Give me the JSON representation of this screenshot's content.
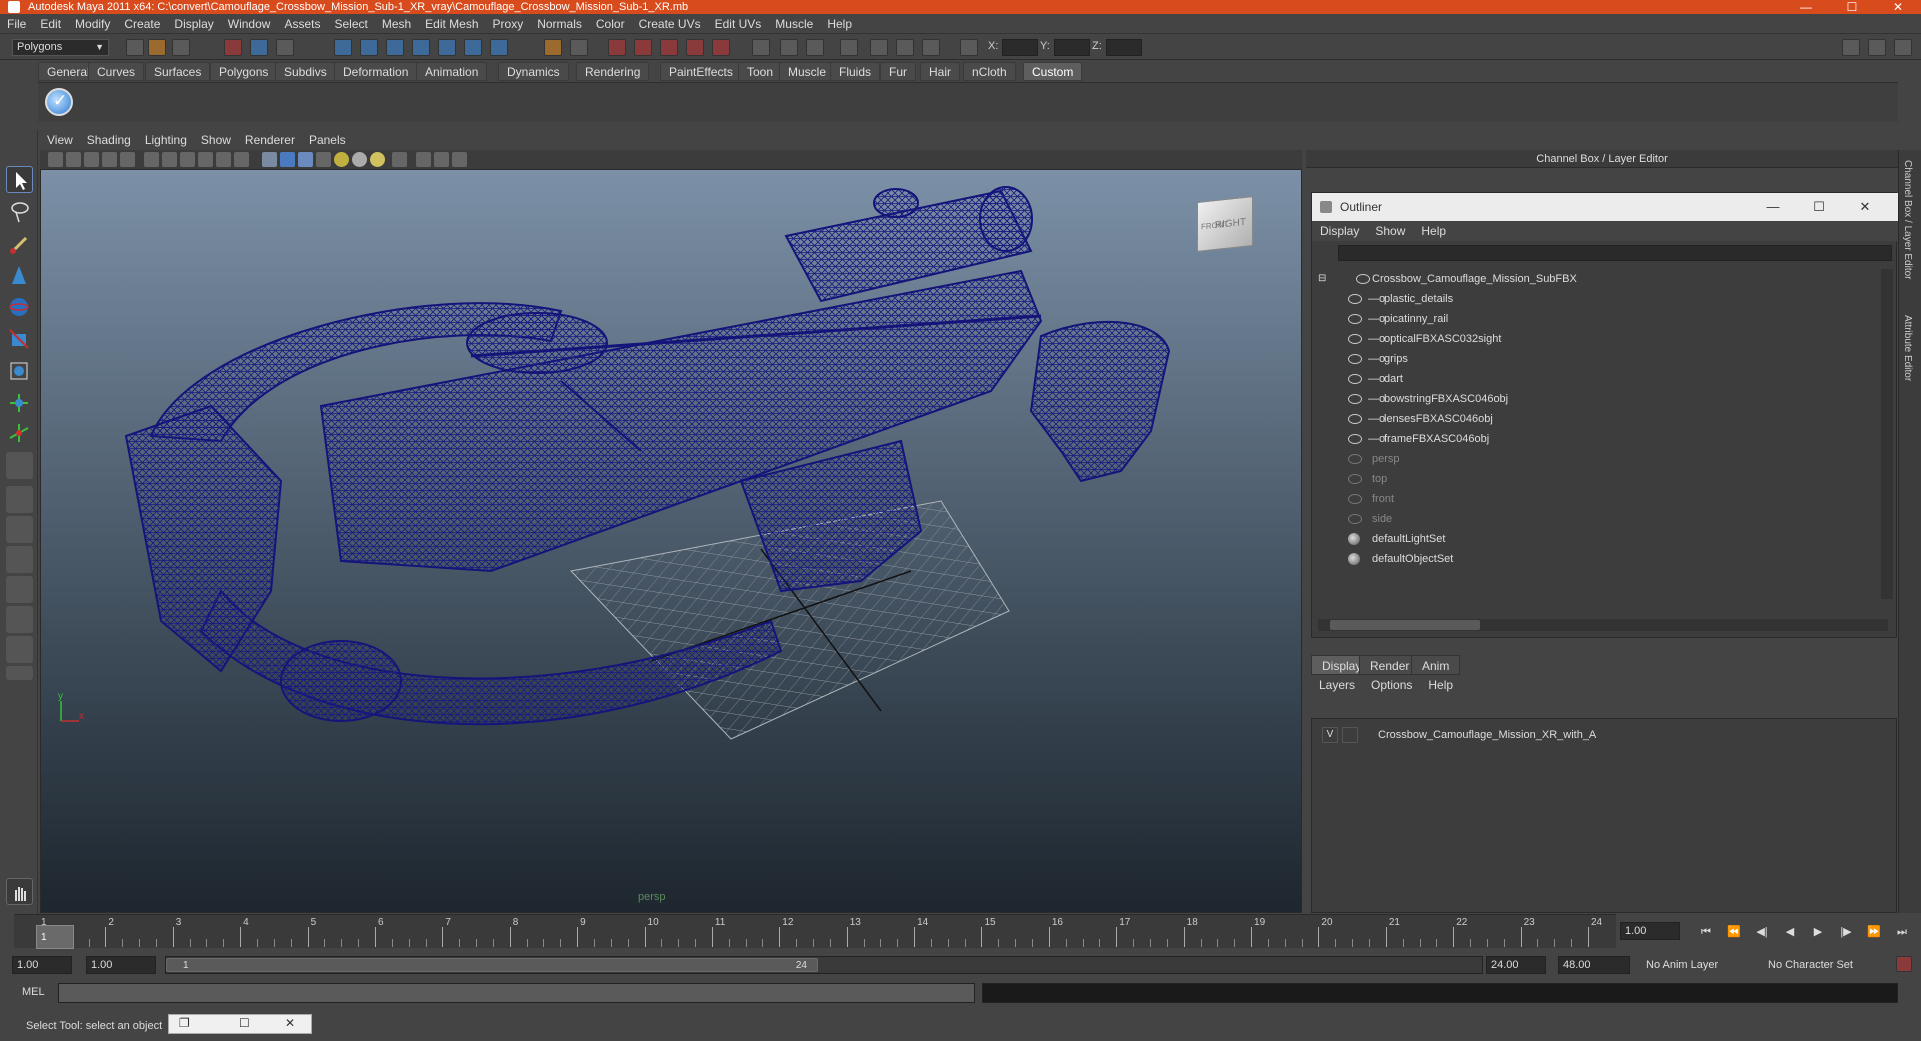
{
  "window": {
    "title": "Autodesk Maya 2011 x64: C:\\convert\\Camouflage_Crossbow_Mission_Sub-1_XR_vray\\Camouflage_Crossbow_Mission_Sub-1_XR.mb",
    "min": "—",
    "max": "☐",
    "close": "✕"
  },
  "menubar": [
    "File",
    "Edit",
    "Modify",
    "Create",
    "Display",
    "Window",
    "Assets",
    "Select",
    "Mesh",
    "Edit Mesh",
    "Proxy",
    "Normals",
    "Color",
    "Create UVs",
    "Edit UVs",
    "Muscle",
    "Help"
  ],
  "statusline": {
    "mode": "Polygons",
    "x_label": "X:",
    "y_label": "Y:",
    "z_label": "Z:"
  },
  "shelf": {
    "tabs": [
      "General",
      "Curves",
      "Surfaces",
      "Polygons",
      "Subdivs",
      "Deformation",
      "Animation",
      "Dynamics",
      "Rendering",
      "PaintEffects",
      "Toon",
      "Muscle",
      "Fluids",
      "Fur",
      "Hair",
      "nCloth",
      "Custom"
    ],
    "active": "Custom"
  },
  "viewport": {
    "menu": [
      "View",
      "Shading",
      "Lighting",
      "Show",
      "Renderer",
      "Panels"
    ],
    "camera_label": "persp",
    "viewcube_front": "FRONT",
    "viewcube_right": "RIGHT",
    "axis_x": "x",
    "axis_y": "y"
  },
  "channel_box": {
    "title": "Channel Box / Layer Editor"
  },
  "outliner": {
    "title": "Outliner",
    "min": "—",
    "max": "☐",
    "close": "✕",
    "menu": [
      "Display",
      "Show",
      "Help"
    ],
    "items": [
      {
        "label": "Crossbow_Camouflage_Mission_SubFBX",
        "indent": 0,
        "kind": "group"
      },
      {
        "label": "plastic_details",
        "indent": 1,
        "kind": "mesh"
      },
      {
        "label": "picatinny_rail",
        "indent": 1,
        "kind": "mesh"
      },
      {
        "label": "opticalFBXASC032sight",
        "indent": 1,
        "kind": "mesh"
      },
      {
        "label": "grips",
        "indent": 1,
        "kind": "mesh"
      },
      {
        "label": "dart",
        "indent": 1,
        "kind": "mesh"
      },
      {
        "label": "bowstringFBXASC046obj",
        "indent": 1,
        "kind": "mesh"
      },
      {
        "label": "lensesFBXASC046obj",
        "indent": 1,
        "kind": "mesh"
      },
      {
        "label": "frameFBXASC046obj",
        "indent": 1,
        "kind": "mesh"
      },
      {
        "label": "persp",
        "indent": 0,
        "kind": "camera"
      },
      {
        "label": "top",
        "indent": 0,
        "kind": "camera"
      },
      {
        "label": "front",
        "indent": 0,
        "kind": "camera"
      },
      {
        "label": "side",
        "indent": 0,
        "kind": "camera"
      },
      {
        "label": "defaultLightSet",
        "indent": 0,
        "kind": "set"
      },
      {
        "label": "defaultObjectSet",
        "indent": 0,
        "kind": "set"
      }
    ]
  },
  "layer_editor": {
    "tabs": [
      "Display",
      "Render",
      "Anim"
    ],
    "active": "Display",
    "menu": [
      "Layers",
      "Options",
      "Help"
    ],
    "layer": {
      "visible": "V",
      "name": "Crossbow_Camouflage_Mission_XR_with_A"
    }
  },
  "side_tabs": [
    "Channel Box / Layer Editor",
    "Attribute Editor"
  ],
  "timeslider": {
    "labels": [
      "1",
      "2",
      "3",
      "4",
      "5",
      "6",
      "7",
      "8",
      "9",
      "10",
      "11",
      "12",
      "13",
      "14",
      "15",
      "16",
      "17",
      "18",
      "19",
      "20",
      "21",
      "22",
      "23",
      "24"
    ],
    "current_frame": "1",
    "current_frame_field": "1.00"
  },
  "playback": [
    "⏮",
    "⏪",
    "◀|",
    "◀",
    "▶",
    "|▶",
    "⏩",
    "⏭"
  ],
  "range": {
    "start": "1.00",
    "anim_start": "1.00",
    "range_start_label": "1",
    "range_end_label": "24",
    "end": "24.00",
    "anim_end": "48.00",
    "anim_layer": "No Anim Layer",
    "character_set": "No Character Set"
  },
  "cmdline": {
    "label": "MEL"
  },
  "helpline": {
    "text": "Select Tool: select an object"
  }
}
